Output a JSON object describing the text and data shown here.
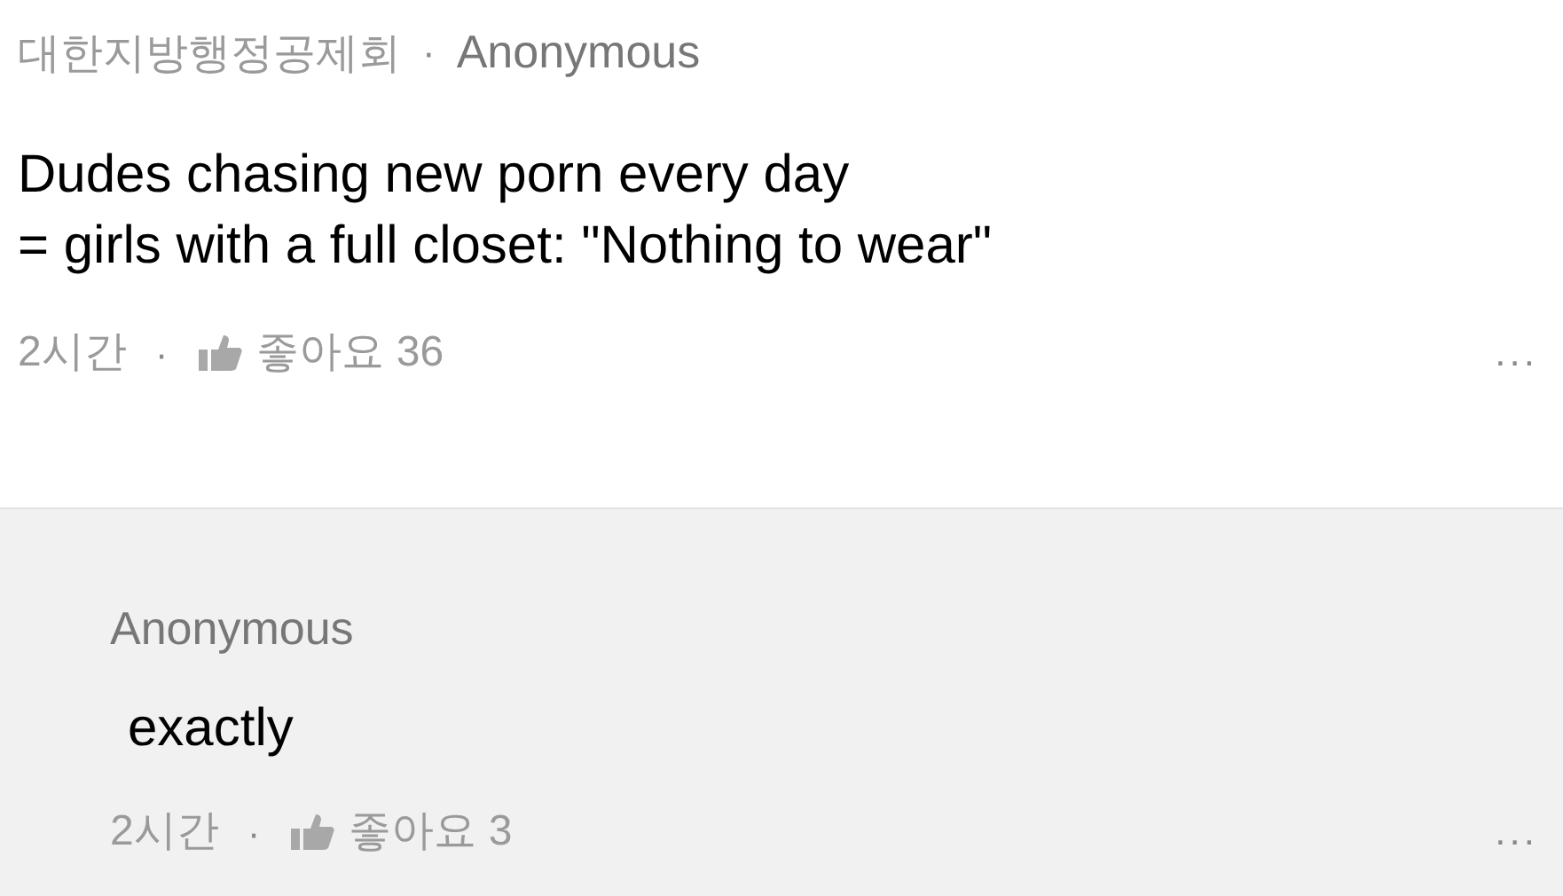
{
  "comment": {
    "group": "대한지방행정공제회",
    "separator": "·",
    "author": "Anonymous",
    "lines": [
      "Dudes chasing new porn every day",
      "= girls with a full closet: \"Nothing to wear\""
    ],
    "time": "2시간",
    "dot": "·",
    "likes": "좋아요 36",
    "more": "..."
  },
  "reply": {
    "author": "Anonymous",
    "text": "exactly",
    "time": "2시간",
    "dot": "·",
    "likes": "좋아요 3",
    "more": "..."
  }
}
